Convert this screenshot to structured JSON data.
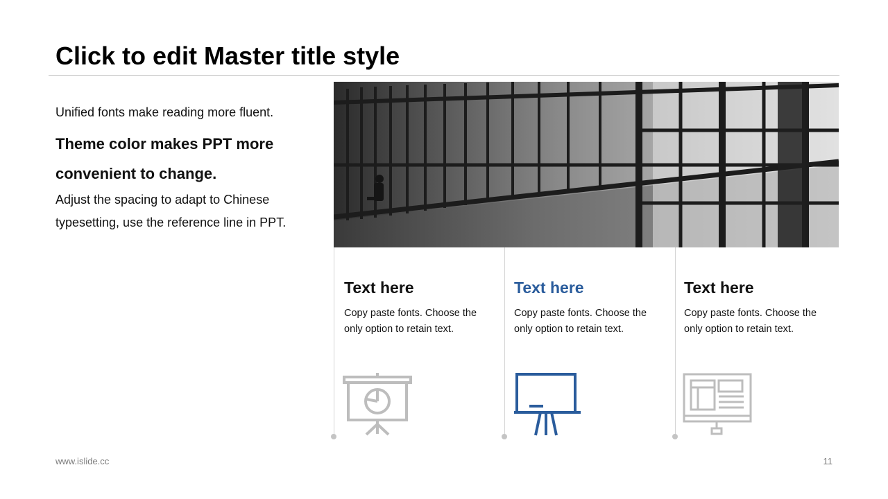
{
  "slide": {
    "title": "Click to edit Master title style",
    "intro": {
      "line1": "Unified fonts make reading more fluent.",
      "line2": "Theme color makes PPT more convenient  to change.",
      "line3": "Adjust the spacing to adapt to Chinese typesetting, use the reference line in PPT."
    },
    "photo": {
      "description_icon": "train-station-window-photo"
    }
  },
  "columns": [
    {
      "title": "Text here",
      "body": "Copy paste fonts. Choose the only option to retain text.",
      "icon": "presentation-pie-chart-icon",
      "accent": false
    },
    {
      "title": "Text here",
      "body": "Copy paste fonts. Choose the only option to retain text.",
      "icon": "whiteboard-easel-icon",
      "accent": true
    },
    {
      "title": "Text here",
      "body": "Copy paste fonts. Choose the only option to retain text.",
      "icon": "monitor-dashboard-icon",
      "accent": false
    }
  ],
  "footer": {
    "url": "www.islide.cc",
    "page": "11"
  },
  "colors": {
    "accent": "#2a5c9c",
    "muted_icon": "#bdbdbd",
    "divider": "#d4d4d4"
  }
}
